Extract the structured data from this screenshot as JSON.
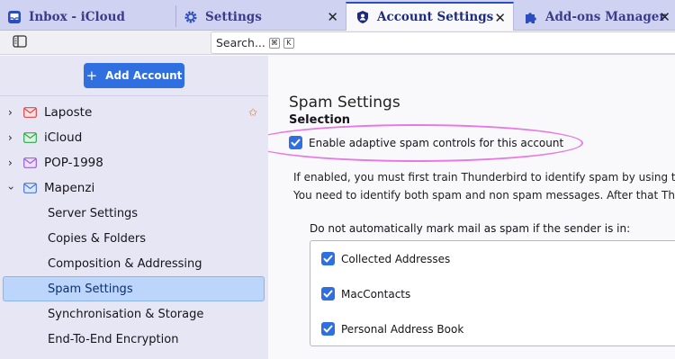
{
  "tabs": [
    {
      "label": "Inbox - iCloud",
      "icon": "inbox-icon",
      "closable": false
    },
    {
      "label": "Settings",
      "icon": "gear-icon",
      "closable": true
    },
    {
      "label": "Account Settings",
      "icon": "account-shield-icon",
      "closable": true,
      "active": true
    },
    {
      "label": "Add-ons Manager",
      "icon": "puzzle-icon",
      "closable": true
    }
  ],
  "toolbar": {
    "search_placeholder": "Search...",
    "shortcut_keys": [
      "⌘",
      "K"
    ]
  },
  "sidebar": {
    "add_account_label": "Add Account",
    "accounts": [
      {
        "label": "Laposte",
        "expanded": false,
        "color": "#e0454c",
        "starred": true
      },
      {
        "label": "iCloud",
        "expanded": false,
        "color": "#2ea84b",
        "starred": false
      },
      {
        "label": "POP-1998",
        "expanded": false,
        "color": "#9b5fd6",
        "starred": false
      },
      {
        "label": "Mapenzi",
        "expanded": true,
        "color": "#4a78d6",
        "starred": false
      }
    ],
    "sub_items": [
      "Server Settings",
      "Copies & Folders",
      "Composition & Addressing",
      "Spam Settings",
      "Synchronisation & Storage",
      "End-To-End Encryption"
    ],
    "selected_sub_item": "Spam Settings"
  },
  "main": {
    "title": "Spam Settings",
    "section": "Selection",
    "enable_label": "Enable adaptive spam controls for this account",
    "enable_checked": true,
    "para1": "If enabled, you must first train Thunderbird to identify spam by using the S",
    "para2": "You need to identify both spam and non spam messages. After that Thunde",
    "donot_label": "Do not automatically mark mail as spam if the sender is in:",
    "address_books": [
      {
        "label": "Collected Addresses",
        "checked": true
      },
      {
        "label": "MacContacts",
        "checked": true
      },
      {
        "label": "Personal Address Book",
        "checked": true
      }
    ]
  },
  "colors": {
    "accent": "#2f6fe0",
    "highlight_ring": "#e57ae2",
    "tabbar_bg": "#cfd2f0",
    "sidebar_bg": "#e6e6f5",
    "selection_bg": "#bcd6fb"
  }
}
